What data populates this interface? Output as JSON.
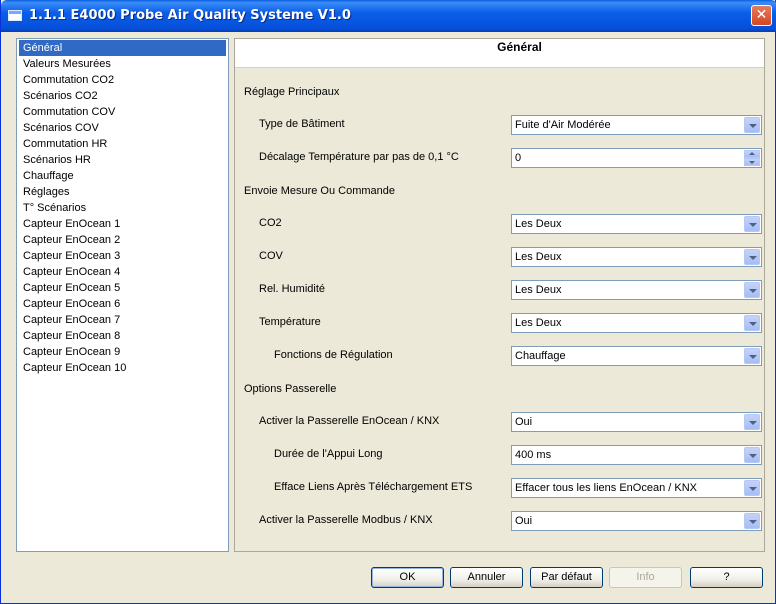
{
  "window": {
    "title": "1.1.1 E4000 Probe Air Quality Systeme V1.0",
    "close_glyph": "✕"
  },
  "sidebar": {
    "items": [
      {
        "label": "Général",
        "selected": true
      },
      {
        "label": "Valeurs Mesurées"
      },
      {
        "label": "Commutation CO2"
      },
      {
        "label": "Scénarios CO2"
      },
      {
        "label": "Commutation COV"
      },
      {
        "label": "Scénarios COV"
      },
      {
        "label": "Commutation HR"
      },
      {
        "label": "Scénarios HR"
      },
      {
        "label": "Chauffage"
      },
      {
        "label": "Réglages"
      },
      {
        "label": "T° Scénarios"
      },
      {
        "label": "Capteur EnOcean 1"
      },
      {
        "label": "Capteur EnOcean 2"
      },
      {
        "label": "Capteur EnOcean 3"
      },
      {
        "label": "Capteur EnOcean 4"
      },
      {
        "label": "Capteur EnOcean 5"
      },
      {
        "label": "Capteur EnOcean 6"
      },
      {
        "label": "Capteur EnOcean 7"
      },
      {
        "label": "Capteur EnOcean 8"
      },
      {
        "label": "Capteur EnOcean 9"
      },
      {
        "label": "Capteur EnOcean 10"
      }
    ]
  },
  "panel": {
    "header": "Général",
    "sections": {
      "principaux": "Réglage Principaux",
      "envoie": "Envoie Mesure Ou Commande",
      "passerelle": "Options Passerelle"
    },
    "fields": {
      "type_batiment": {
        "label": "Type de Bâtiment",
        "value": "Fuite d'Air Modérée"
      },
      "decalage": {
        "label": "Décalage Température par pas de 0,1 °C",
        "value": "0"
      },
      "co2": {
        "label": "CO2",
        "value": "Les Deux"
      },
      "cov": {
        "label": "COV",
        "value": "Les Deux"
      },
      "humidite": {
        "label": "Rel. Humidité",
        "value": "Les Deux"
      },
      "temperature": {
        "label": "Température",
        "value": "Les Deux"
      },
      "regulation": {
        "label": "Fonctions de Régulation",
        "value": "Chauffage"
      },
      "enocean_knx": {
        "label": "Activer la Passerelle EnOcean / KNX",
        "value": "Oui"
      },
      "appui_long": {
        "label": "Durée de l'Appui Long",
        "value": "400 ms"
      },
      "efface_liens": {
        "label": "Efface Liens Après Téléchargement ETS",
        "value": "Effacer tous les liens EnOcean / KNX"
      },
      "modbus_knx": {
        "label": "Activer la Passerelle Modbus / KNX",
        "value": "Oui"
      }
    }
  },
  "buttons": {
    "ok": "OK",
    "cancel": "Annuler",
    "default": "Par défaut",
    "info": "Info",
    "help": "?"
  }
}
